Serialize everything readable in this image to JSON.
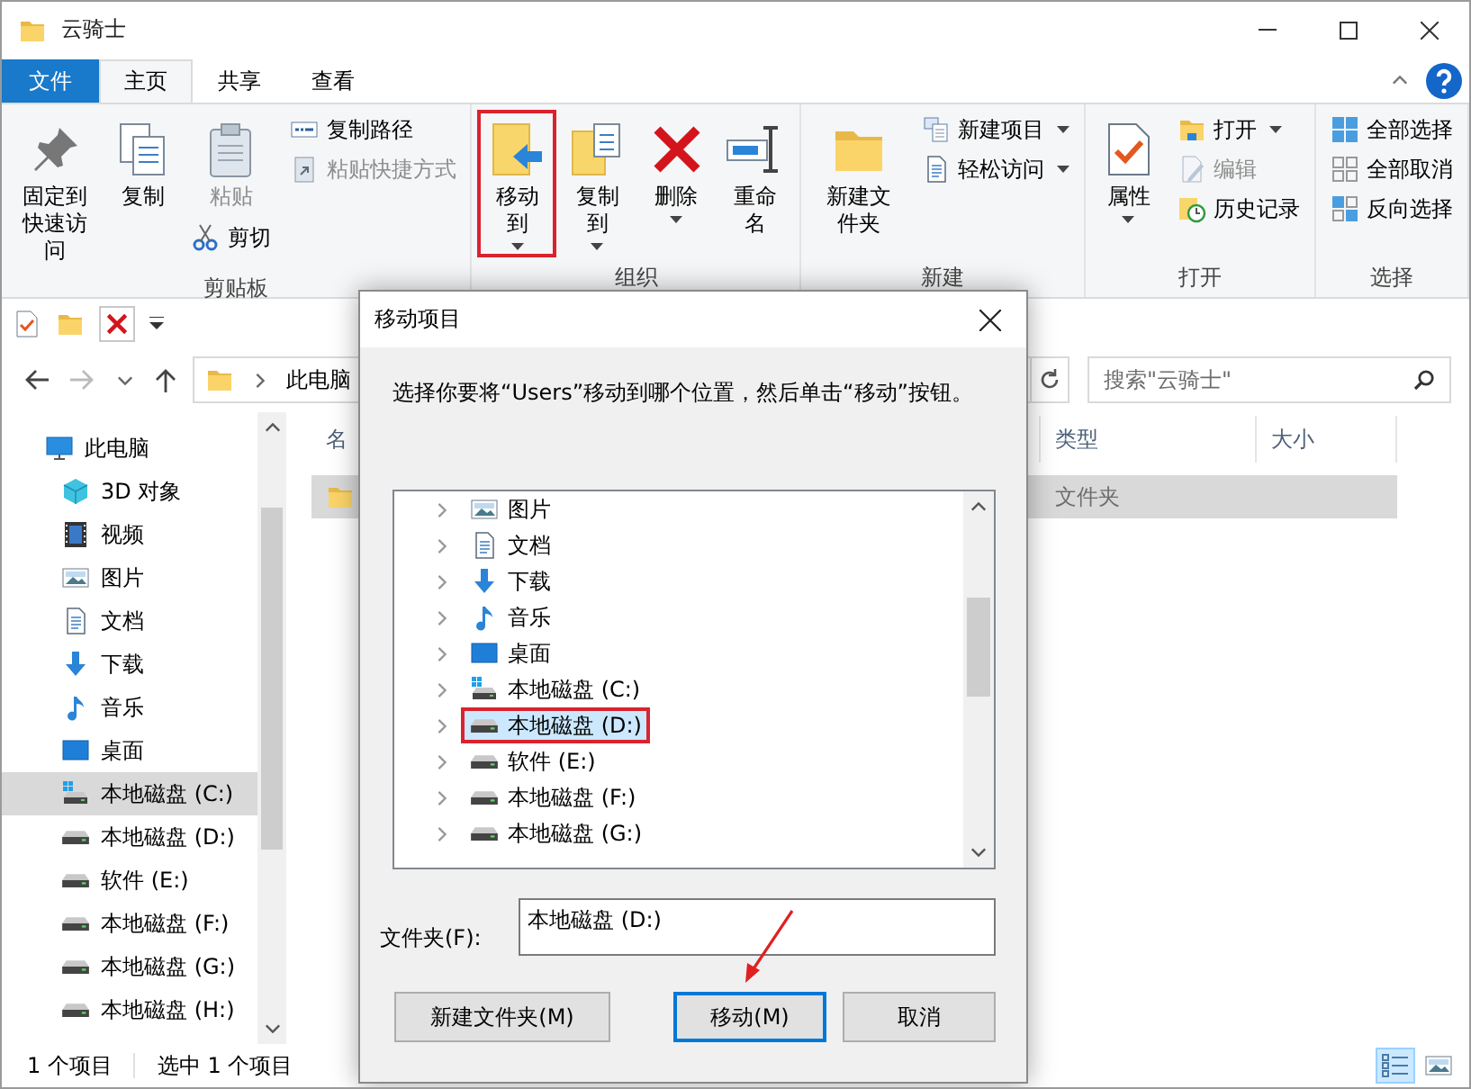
{
  "window": {
    "title": "云骑士"
  },
  "file_menu": {
    "label": "文件"
  },
  "ribbon_tabs": [
    {
      "label": "主页",
      "selected": true
    },
    {
      "label": "共享",
      "selected": false
    },
    {
      "label": "查看",
      "selected": false
    }
  ],
  "ribbon_groups": [
    {
      "label": "剪贴板",
      "items": [
        {
          "kind": "large",
          "label": "固定到快速访问",
          "disabled": false,
          "dropdown": false,
          "highlighted": false
        },
        {
          "kind": "large",
          "label": "复制",
          "disabled": false,
          "dropdown": false,
          "highlighted": false
        },
        {
          "kind": "stack",
          "items": [
            {
              "kind": "large",
              "label": "粘贴",
              "disabled": true,
              "dropdown": false,
              "highlighted": false
            },
            {
              "kind": "small",
              "label": "剪切",
              "disabled": false,
              "dropdown": false,
              "highlighted": false
            }
          ]
        },
        {
          "kind": "stack",
          "items": [
            {
              "kind": "small",
              "label": "复制路径",
              "disabled": false,
              "dropdown": false,
              "highlighted": false
            },
            {
              "kind": "small",
              "label": "粘贴快捷方式",
              "disabled": true,
              "dropdown": false,
              "highlighted": false
            }
          ]
        }
      ]
    },
    {
      "label": "组织",
      "items": [
        {
          "kind": "large",
          "label": "移动到",
          "disabled": false,
          "dropdown": true,
          "highlighted": true
        },
        {
          "kind": "large",
          "label": "复制到",
          "disabled": false,
          "dropdown": true,
          "highlighted": false
        },
        {
          "kind": "large",
          "label": "删除",
          "disabled": false,
          "dropdown": true,
          "highlighted": false
        },
        {
          "kind": "large",
          "label": "重命名",
          "disabled": false,
          "dropdown": false,
          "highlighted": false
        }
      ]
    },
    {
      "label": "新建",
      "items": [
        {
          "kind": "large",
          "label": "新建文件夹",
          "disabled": false,
          "dropdown": false,
          "highlighted": false
        },
        {
          "kind": "stack",
          "items": [
            {
              "kind": "small",
              "label": "新建项目",
              "disabled": false,
              "dropdown": true,
              "highlighted": false
            },
            {
              "kind": "small",
              "label": "轻松访问",
              "disabled": false,
              "dropdown": true,
              "highlighted": false
            }
          ]
        }
      ]
    },
    {
      "label": "打开",
      "items": [
        {
          "kind": "large",
          "label": "属性",
          "disabled": false,
          "dropdown": true,
          "highlighted": false
        },
        {
          "kind": "stack",
          "items": [
            {
              "kind": "small",
              "label": "打开",
              "disabled": false,
              "dropdown": true,
              "highlighted": false
            },
            {
              "kind": "small",
              "label": "编辑",
              "disabled": true,
              "dropdown": false,
              "highlighted": false
            },
            {
              "kind": "small",
              "label": "历史记录",
              "disabled": false,
              "dropdown": false,
              "highlighted": false
            }
          ]
        }
      ]
    },
    {
      "label": "选择",
      "items": [
        {
          "kind": "stack",
          "items": [
            {
              "kind": "small",
              "label": "全部选择",
              "disabled": false,
              "dropdown": false,
              "highlighted": false
            },
            {
              "kind": "small",
              "label": "全部取消",
              "disabled": false,
              "dropdown": false,
              "highlighted": false
            },
            {
              "kind": "small",
              "label": "反向选择",
              "disabled": false,
              "dropdown": false,
              "highlighted": false
            }
          ]
        }
      ]
    }
  ],
  "address": {
    "crumbs": [
      "此电脑"
    ]
  },
  "search": {
    "placeholder": "搜索\"云骑士\""
  },
  "nav_pane": [
    {
      "label": "此电脑",
      "kind": "pc",
      "selected": false,
      "children": [
        {
          "label": "3D 对象",
          "kind": "objects3d",
          "selected": false
        },
        {
          "label": "视频",
          "kind": "video",
          "selected": false
        },
        {
          "label": "图片",
          "kind": "pictures",
          "selected": false
        },
        {
          "label": "文档",
          "kind": "documents",
          "selected": false
        },
        {
          "label": "下载",
          "kind": "downloads",
          "selected": false
        },
        {
          "label": "音乐",
          "kind": "music",
          "selected": false
        },
        {
          "label": "桌面",
          "kind": "desktop",
          "selected": false
        },
        {
          "label": "本地磁盘 (C:)",
          "kind": "systemdrive",
          "selected": true
        },
        {
          "label": "本地磁盘 (D:)",
          "kind": "drive",
          "selected": false
        },
        {
          "label": "软件 (E:)",
          "kind": "drive",
          "selected": false
        },
        {
          "label": "本地磁盘 (F:)",
          "kind": "drive",
          "selected": false
        },
        {
          "label": "本地磁盘 (G:)",
          "kind": "drive",
          "selected": false
        },
        {
          "label": "本地磁盘 (H:)",
          "kind": "drive",
          "selected": false
        }
      ]
    }
  ],
  "file_list": {
    "columns": [
      "名",
      "类型",
      "大小"
    ],
    "rows": [
      {
        "type": "文件夹",
        "selected": true
      }
    ]
  },
  "status_bar": {
    "count": "1 个项目",
    "selection": "选中 1 个项目"
  },
  "views": [
    {
      "kind": "details",
      "selected": true
    },
    {
      "kind": "icons",
      "selected": false
    }
  ],
  "dialog": {
    "title": "移动项目",
    "instruction": "选择你要将“Users”移动到哪个位置，然后单击“移动”按钮。",
    "tree": [
      {
        "label": "图片",
        "kind": "pictures",
        "selected": false,
        "highlighted": false
      },
      {
        "label": "文档",
        "kind": "documents",
        "selected": false,
        "highlighted": false
      },
      {
        "label": "下载",
        "kind": "downloads",
        "selected": false,
        "highlighted": false
      },
      {
        "label": "音乐",
        "kind": "music",
        "selected": false,
        "highlighted": false
      },
      {
        "label": "桌面",
        "kind": "desktop",
        "selected": false,
        "highlighted": false
      },
      {
        "label": "本地磁盘 (C:)",
        "kind": "systemdrive",
        "selected": false,
        "highlighted": false
      },
      {
        "label": "本地磁盘 (D:)",
        "kind": "drive",
        "selected": true,
        "highlighted": true
      },
      {
        "label": "软件 (E:)",
        "kind": "drive",
        "selected": false,
        "highlighted": false
      },
      {
        "label": "本地磁盘 (F:)",
        "kind": "drive",
        "selected": false,
        "highlighted": false
      },
      {
        "label": "本地磁盘 (G:)",
        "kind": "drive",
        "selected": false,
        "highlighted": false
      }
    ],
    "folder_label": "文件夹(F):",
    "folder_value": "本地磁盘 (D:)",
    "buttons": [
      {
        "label": "新建文件夹(M)",
        "default": false,
        "annotated": false
      },
      {
        "label": "移动(M)",
        "default": true,
        "annotated": true
      },
      {
        "label": "取消",
        "default": false,
        "annotated": false
      }
    ]
  }
}
